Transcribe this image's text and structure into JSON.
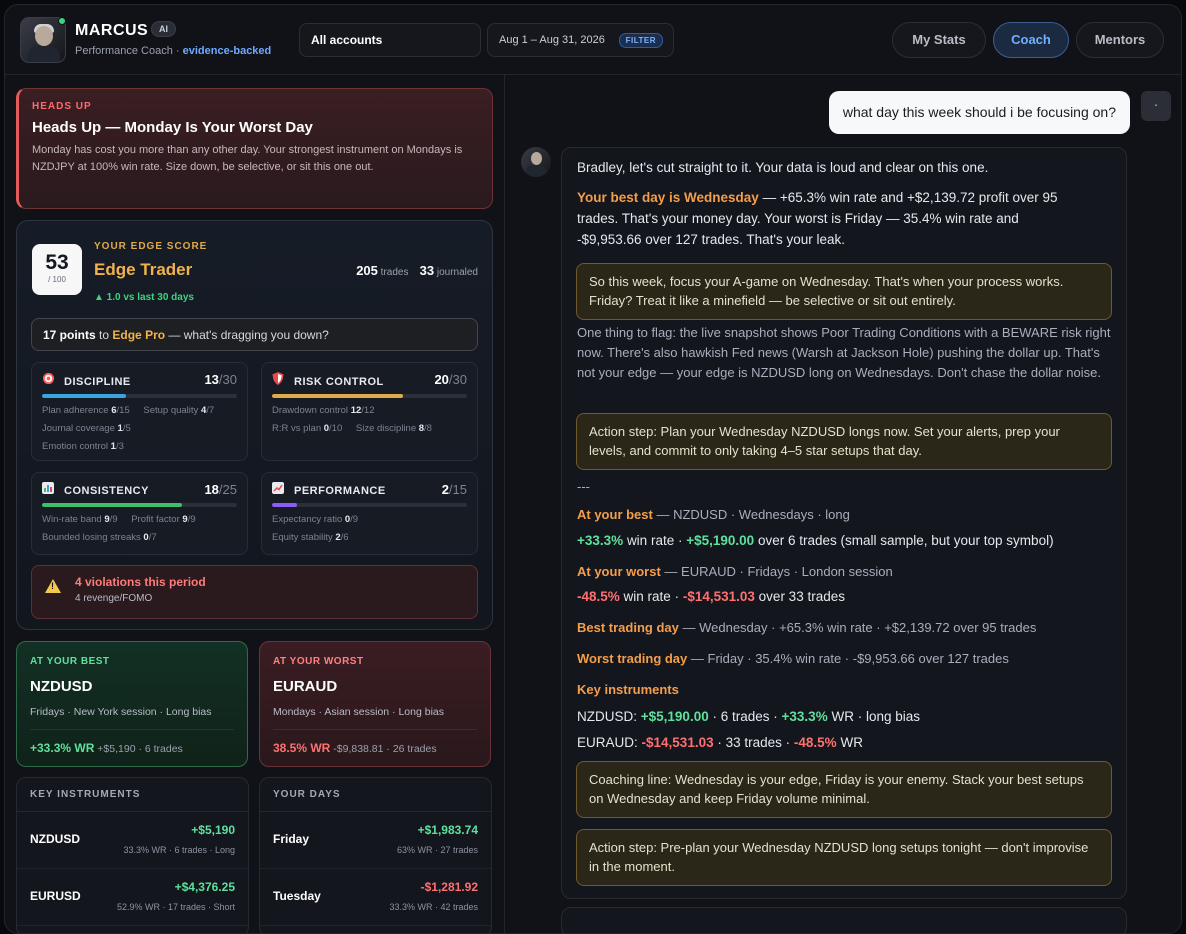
{
  "header": {
    "coach_name": "MARCUS",
    "ai_badge": "AI",
    "subtitle": "Performance Coach ·",
    "subtitle_accent": "evidence-backed",
    "account_select": "All accounts",
    "date_range": "Aug 1 – Aug 31, 2026",
    "filter_badge": "FILTER",
    "nav": [
      {
        "label": "My Stats",
        "active": false
      },
      {
        "label": "Coach",
        "active": true
      },
      {
        "label": "Mentors",
        "active": false
      }
    ]
  },
  "heads_up": {
    "kicker": "HEADS UP",
    "title": "Heads Up — Monday Is Your Worst Day",
    "body": "Monday has cost you more than any other day. Your strongest instrument on Mondays is NZDJPY at 100% win rate. Size down, be selective, or sit this one out."
  },
  "edge": {
    "score": "53",
    "score_den": "/ 100",
    "kicker": "YOUR EDGE SCORE",
    "title": "Edge Trader",
    "delta": "▲ 1.0 vs last 30 days",
    "trades_num": "205",
    "trades_label": "trades",
    "journaled_num": "33",
    "journaled_label": "journaled",
    "points_num": "17 points",
    "points_to": "to",
    "points_target": "Edge Pro",
    "points_rest": "— what's dragging you down?",
    "metrics": [
      {
        "name": "DISCIPLINE",
        "icon": "target-icon",
        "score": "13",
        "max": "/30",
        "fill": 0.43,
        "color": "#3ba3e0",
        "subs": [
          {
            "label": "Plan adherence",
            "val": "6",
            "max": "/15"
          },
          {
            "label": "Setup quality",
            "val": "4",
            "max": "/7"
          },
          {
            "label": "Journal coverage",
            "val": "1",
            "max": "/5"
          },
          {
            "label": "Emotion control",
            "val": "1",
            "max": "/3"
          }
        ]
      },
      {
        "name": "RISK CONTROL",
        "icon": "shield-icon",
        "score": "20",
        "max": "/30",
        "fill": 0.67,
        "color": "#e0a94a",
        "subs": [
          {
            "label": "Drawdown control",
            "val": "12",
            "max": "/12"
          },
          {
            "label": "R:R vs plan",
            "val": "0",
            "max": "/10"
          },
          {
            "label": "Size discipline",
            "val": "8",
            "max": "/8"
          }
        ]
      },
      {
        "name": "CONSISTENCY",
        "icon": "bar-chart-icon",
        "score": "18",
        "max": "/25",
        "fill": 0.72,
        "color": "#3fbf6a",
        "subs": [
          {
            "label": "Win-rate band",
            "val": "9",
            "max": "/9"
          },
          {
            "label": "Profit factor",
            "val": "9",
            "max": "/9"
          },
          {
            "label": "Bounded losing streaks",
            "val": "0",
            "max": "/7"
          }
        ]
      },
      {
        "name": "PERFORMANCE",
        "icon": "trend-chart-icon",
        "score": "2",
        "max": "/15",
        "fill": 0.13,
        "color": "#8b5cf6",
        "subs": [
          {
            "label": "Expectancy ratio",
            "val": "0",
            "max": "/9"
          },
          {
            "label": "Equity stability",
            "val": "2",
            "max": "/6"
          }
        ]
      }
    ],
    "violations_title": "4 violations this period",
    "violations_sub": "4 revenge/FOMO"
  },
  "best": {
    "kicker": "AT YOUR BEST",
    "symbol": "NZDUSD",
    "desc": "Fridays · New York session · Long bias",
    "wr": "+33.3% WR",
    "meta": "+$5,190 · 6 trades"
  },
  "worst": {
    "kicker": "AT YOUR WORST",
    "symbol": "EURAUD",
    "desc": "Mondays · Asian session · Long bias",
    "wr": "38.5% WR",
    "meta": "-$9,838.81 · 26 trades"
  },
  "instruments": {
    "title": "KEY INSTRUMENTS",
    "rows": [
      {
        "symbol": "NZDUSD",
        "value": "+$5,190",
        "meta": "33.3% WR · 6 trades · Long",
        "positive": true
      },
      {
        "symbol": "EURUSD",
        "value": "+$4,376.25",
        "meta": "52.9% WR · 17 trades · Short",
        "positive": true
      }
    ]
  },
  "days": {
    "title": "YOUR DAYS",
    "rows": [
      {
        "day": "Friday",
        "value": "+$1,983.74",
        "meta": "63% WR · 27 trades",
        "positive": true
      },
      {
        "day": "Tuesday",
        "value": "-$1,281.92",
        "meta": "33.3% WR · 42 trades",
        "positive": false
      }
    ]
  },
  "chat": {
    "user_message": "what day this week should i be focusing on?",
    "user_mini": "·",
    "intro": "Bradley, let's cut straight to it. Your data is loud and clear on this one.",
    "best_day_lead": "Your best day is Wednesday",
    "best_day_rest_1": "— +65.3% win rate and +$2,139.72 profit over 95",
    "best_day_rest_2": "trades. That's your money day. Your worst is Friday — 35.4% win rate and",
    "best_day_rest_3": "-$9,953.66 over 127 trades. That's your leak.",
    "callout_1": "So this week, focus your A-game on Wednesday. That's when your process works. Friday? Treat it like a minefield — be selective or sit out entirely.",
    "flag": "One thing to flag: the live snapshot shows Poor Trading Conditions with a BEWARE risk right now. There's also hawkish Fed news (Warsh at Jackson Hole) pushing the dollar up. That's not your edge — your edge is NZDUSD long on Wednesdays. Don't chase the dollar noise.",
    "callout_2": "Action step: Plan your Wednesday NZDUSD longs now. Set your alerts, prep your levels, and commit to only taking 4–5 star setups that day.",
    "divider": "---",
    "best_label": "At your best",
    "best_rest": "— NZDUSD · Wednesdays · long",
    "best_wr": "+33.3%",
    "best_wr_label": "win rate ·",
    "best_pnl": "+$5,190.00",
    "best_tail": "over 6 trades (small sample, but your top symbol)",
    "worst_label": "At your worst",
    "worst_rest": "— EURAUD · Fridays · London session",
    "worst_wr": "-48.5%",
    "worst_wr_label": "win rate ·",
    "worst_pnl": "-$14,531.03",
    "worst_tail": "over 33 trades",
    "best_day_label": "Best trading day",
    "best_day_line": "— Wednesday · +65.3% win rate · +$2,139.72 over 95 trades",
    "worst_day_label": "Worst trading day",
    "worst_day_line": "— Friday · 35.4% win rate · -$9,953.66 over 127 trades",
    "key_label": "Key instruments",
    "k1_sym": "NZDUSD:",
    "k1_pnl": "+$5,190.00",
    "k1_mid": "· 6 trades ·",
    "k1_wr": "+33.3%",
    "k1_tail": "WR · long bias",
    "k2_sym": "EURAUD:",
    "k2_pnl": "-$14,531.03",
    "k2_mid": "· 33 trades ·",
    "k2_wr": "-48.5%",
    "k2_tail": "WR",
    "callout_3": "Coaching line: Wednesday is your edge, Friday is your enemy. Stack your best setups on Wednesday and keep Friday volume minimal.",
    "callout_4": "Action step: Pre-plan your Wednesday NZDUSD long setups tonight — don't improvise in the moment."
  },
  "colors": {
    "accent_blue": "#6fb0ff",
    "gold": "#f0b24c",
    "positive": "#5fe09c",
    "negative": "#ff7070"
  }
}
